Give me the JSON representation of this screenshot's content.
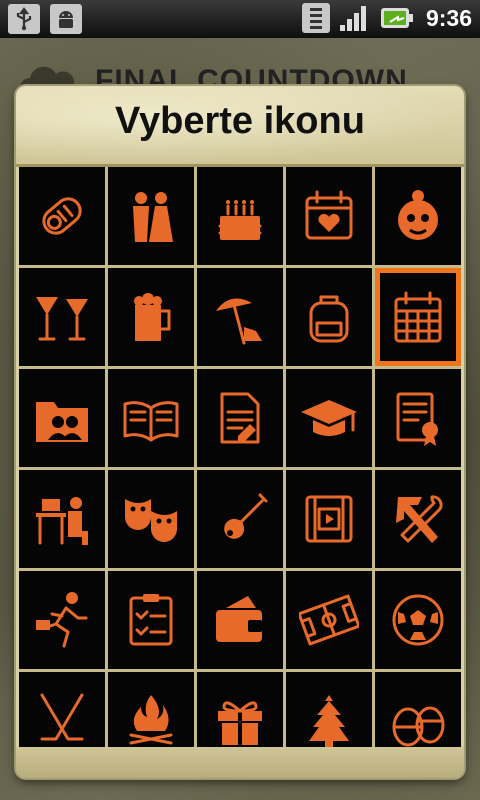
{
  "status_bar": {
    "time": "9:36"
  },
  "background_app": {
    "title": "FINAL COUNTDOWN"
  },
  "dialog": {
    "title": "Vyberte ikonu"
  },
  "icons": [
    "baby-icon",
    "wedding-couple-icon",
    "birthday-cake-icon",
    "calendar-heart-icon",
    "grandma-icon",
    "cocktails-icon",
    "beer-mug-icon",
    "beach-umbrella-icon",
    "backpack-icon",
    "calendar-icon",
    "contacts-folder-icon",
    "open-book-icon",
    "document-icon",
    "graduation-cap-icon",
    "certificate-icon",
    "office-worker-icon",
    "theater-masks-icon",
    "guitar-icon",
    "film-icon",
    "tools-icon",
    "running-man-icon",
    "checklist-icon",
    "wallet-icon",
    "football-pitch-icon",
    "soccer-ball-icon",
    "hockey-sticks-icon",
    "campfire-icon",
    "gift-icon",
    "christmas-tree-icon",
    "easter-eggs-icon"
  ],
  "selected_icon": "calendar-icon",
  "accent_color": "#e86a2a",
  "selection_color": "#f0741c"
}
